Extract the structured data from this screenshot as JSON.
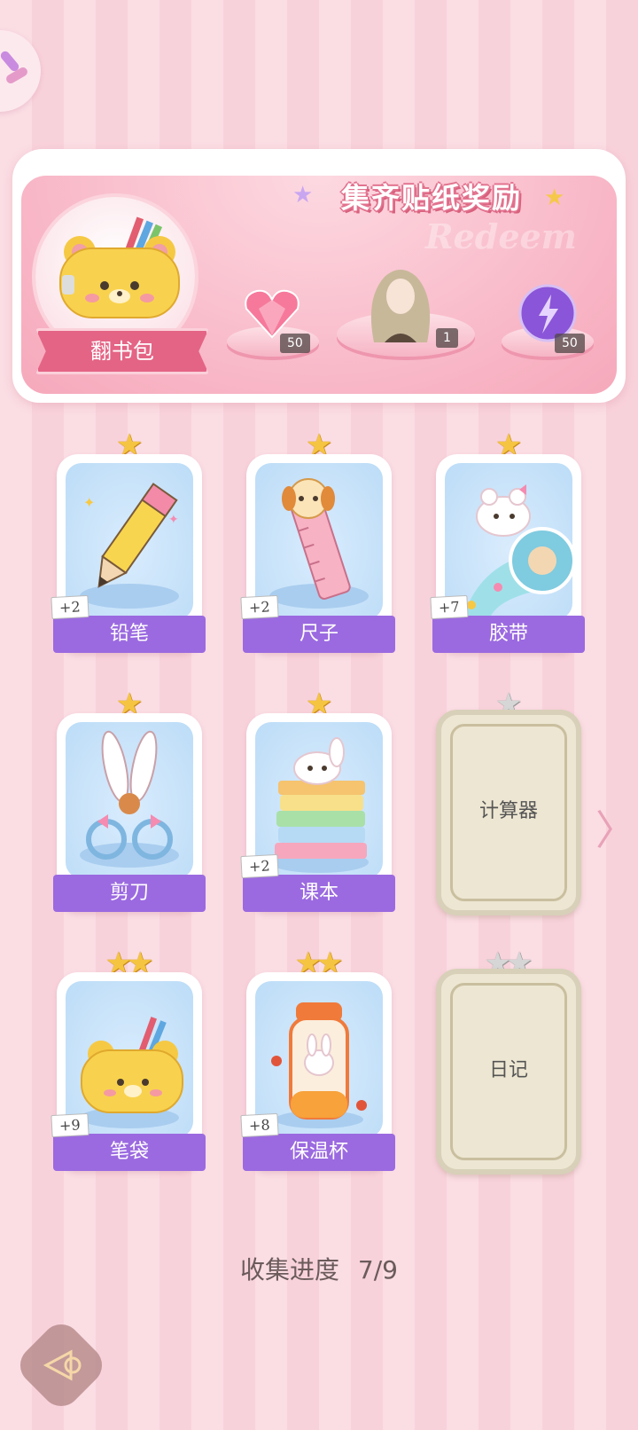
{
  "banner": {
    "title": "集齐贴纸奖励",
    "deco_text": "Redeem",
    "pouch_label": "翻书包",
    "rewards": [
      {
        "icon": "pink-heart-gem-icon",
        "count": "50"
      },
      {
        "icon": "doll-avatar-icon",
        "count": "1"
      },
      {
        "icon": "purple-energy-orb-icon",
        "count": "50"
      }
    ]
  },
  "cards": [
    {
      "name": "铅笔",
      "plus": "+2",
      "stars": 1,
      "unlocked": true
    },
    {
      "name": "尺子",
      "plus": "+2",
      "stars": 1,
      "unlocked": true
    },
    {
      "name": "胶带",
      "plus": "+7",
      "stars": 1,
      "unlocked": true
    },
    {
      "name": "剪刀",
      "plus": "",
      "stars": 1,
      "unlocked": true
    },
    {
      "name": "课本",
      "plus": "+2",
      "stars": 1,
      "unlocked": true
    },
    {
      "name": "计算器",
      "plus": "",
      "stars": 1,
      "unlocked": false
    },
    {
      "name": "笔袋",
      "plus": "+9",
      "stars": 2,
      "unlocked": true
    },
    {
      "name": "保温杯",
      "plus": "+8",
      "stars": 2,
      "unlocked": true
    },
    {
      "name": "日记",
      "plus": "",
      "stars": 2,
      "unlocked": false
    }
  ],
  "progress": {
    "label": "收集进度",
    "value": "7/9"
  },
  "colors": {
    "accent": "#9b6ae0",
    "label_pink": "#e46485",
    "star_gold": "#f5c542"
  }
}
